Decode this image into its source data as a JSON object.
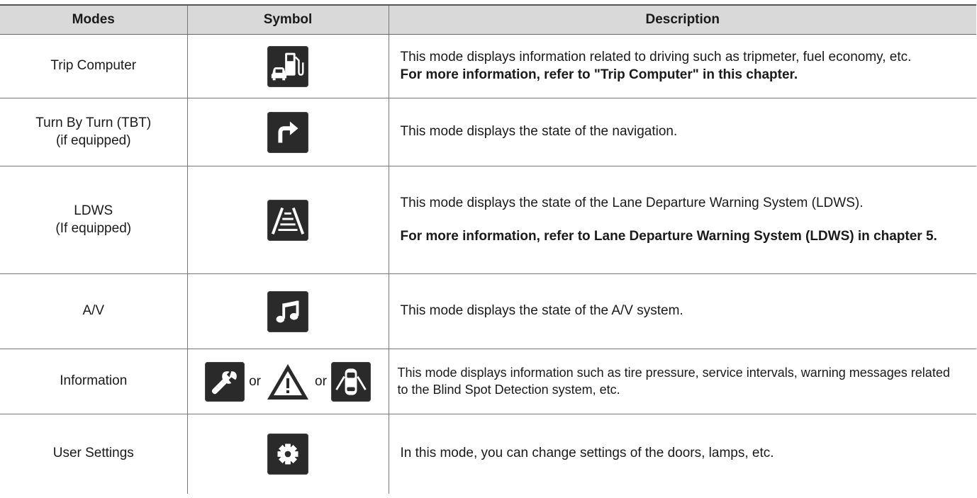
{
  "headers": {
    "modes": "Modes",
    "symbol": "Symbol",
    "description": "Description"
  },
  "rows": [
    {
      "mode": "Trip Computer",
      "icon": "fuel-pump-car-icon",
      "desc": "This mode displays information related to driving such as tripmeter, fuel economy, etc.",
      "note": "For more information, refer to \"Trip Computer\" in this chapter."
    },
    {
      "mode": "Turn By Turn (TBT)",
      "mode_sub": "(if equipped)",
      "icon": "turn-right-arrow-icon",
      "desc": "This mode displays the state of the navigation."
    },
    {
      "mode": "LDWS",
      "mode_sub": "(If equipped)",
      "icon": "lane-departure-icon",
      "desc": "This mode displays the state of the Lane Departure Warning System (LDWS).",
      "note": "For more information, refer to Lane Departure Warning System (LDWS) in chapter 5."
    },
    {
      "mode": "A/V",
      "icon": "music-note-icon",
      "desc": "This mode displays the state of the A/V system."
    },
    {
      "mode": "Information",
      "icons": [
        "wrench-icon",
        "warning-triangle-icon",
        "car-doors-open-icon"
      ],
      "or": "or",
      "desc": "This mode displays information such as tire pressure, service intervals, warning messages related to the Blind Spot Detection system, etc."
    },
    {
      "mode": "User Settings",
      "icon": "gear-icon",
      "desc": "In this mode, you can change settings of the doors, lamps, etc."
    }
  ]
}
